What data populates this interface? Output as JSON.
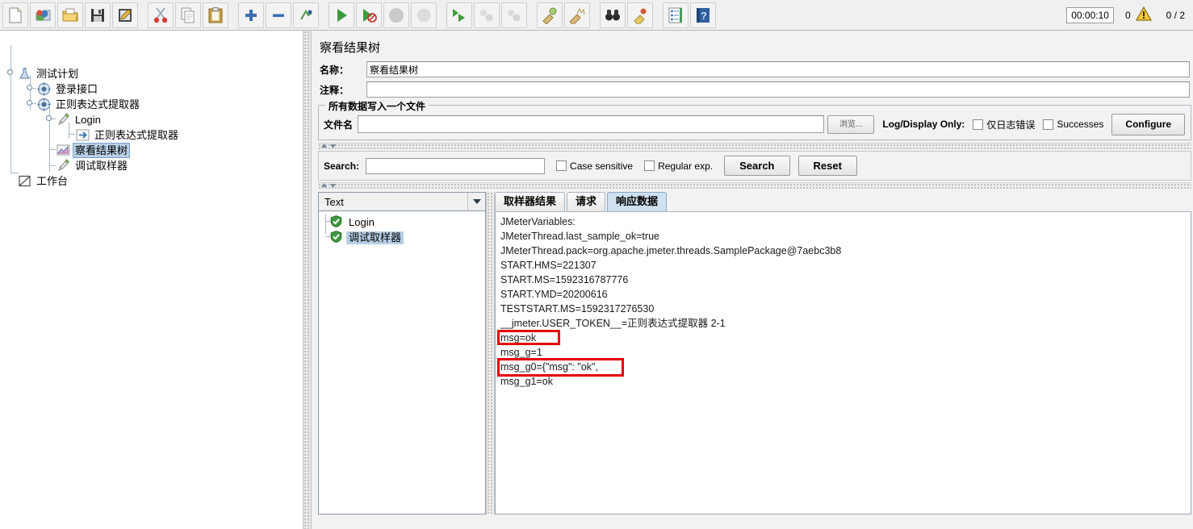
{
  "toolbar": {
    "buttons": [
      {
        "name": "new-test-plan",
        "icon": "new-file-icon",
        "tooltip": "New"
      },
      {
        "name": "templates",
        "icon": "templates-icon",
        "tooltip": "Templates"
      },
      {
        "name": "open",
        "icon": "open-folder-icon",
        "tooltip": "Open"
      },
      {
        "name": "save",
        "icon": "save-disk-icon",
        "tooltip": "Save"
      },
      {
        "name": "save-as",
        "icon": "save-as-icon",
        "tooltip": "Save Test Plan as"
      },
      {
        "name": "cut",
        "icon": "scissors-icon",
        "tooltip": "Cut"
      },
      {
        "name": "copy",
        "icon": "copy-icon",
        "tooltip": "Copy"
      },
      {
        "name": "paste",
        "icon": "clipboard-paste-icon",
        "tooltip": "Paste"
      },
      {
        "name": "expand-all",
        "icon": "plus-icon",
        "tooltip": "Expand All"
      },
      {
        "name": "collapse-all",
        "icon": "minus-icon",
        "tooltip": "Collapse All"
      },
      {
        "name": "toggle",
        "icon": "toggle-icon",
        "tooltip": "Toggle"
      },
      {
        "name": "start",
        "icon": "play-green-icon",
        "tooltip": "Start"
      },
      {
        "name": "start-no-pauses",
        "icon": "play-no-pause-icon",
        "tooltip": "Start no pauses"
      },
      {
        "name": "stop",
        "icon": "stop-disabled-icon",
        "tooltip": "Stop"
      },
      {
        "name": "shutdown",
        "icon": "shutdown-disabled-icon",
        "tooltip": "Shutdown"
      },
      {
        "name": "remote-start-all",
        "icon": "remote-start-icon",
        "tooltip": "Remote Start All"
      },
      {
        "name": "remote-stop-all",
        "icon": "remote-stop-disabled-icon",
        "tooltip": "Remote Stop All"
      },
      {
        "name": "remote-shutdown-all",
        "icon": "remote-shutdown-disabled-icon",
        "tooltip": "Remote Shutdown All"
      },
      {
        "name": "clear",
        "icon": "clear-broom-icon",
        "tooltip": "Clear"
      },
      {
        "name": "clear-all",
        "icon": "clear-all-broom-icon",
        "tooltip": "Clear All"
      },
      {
        "name": "search",
        "icon": "binoculars-icon",
        "tooltip": "Search"
      },
      {
        "name": "search-reset",
        "icon": "search-reset-icon",
        "tooltip": "Reset Search"
      },
      {
        "name": "function-helper",
        "icon": "function-list-icon",
        "tooltip": "Function Helper Dialog"
      },
      {
        "name": "help",
        "icon": "help-book-icon",
        "tooltip": "Help"
      }
    ],
    "status": {
      "elapsed_time": "00:00:10",
      "error_count": "0",
      "warn_icon": "warning-triangle-icon",
      "threads": "0 / 2"
    }
  },
  "tree": {
    "nodes": [
      {
        "label": "测试计划",
        "icon": "test-plan-icon",
        "depth": 0,
        "selected": false
      },
      {
        "label": "登录接口",
        "icon": "thread-group-icon",
        "depth": 1,
        "selected": false
      },
      {
        "label": "正则表达式提取器",
        "icon": "thread-group-icon",
        "depth": 1,
        "selected": false
      },
      {
        "label": "Login",
        "icon": "sampler-icon",
        "depth": 2,
        "selected": false
      },
      {
        "label": "正则表达式提取器",
        "icon": "post-processor-icon",
        "depth": 3,
        "selected": false
      },
      {
        "label": "察看结果树",
        "icon": "view-results-tree-icon",
        "depth": 2,
        "selected": true
      },
      {
        "label": "调试取样器",
        "icon": "sampler-icon",
        "depth": 2,
        "selected": false
      },
      {
        "label": "工作台",
        "icon": "workbench-icon",
        "depth": 0,
        "selected": false
      }
    ]
  },
  "panel": {
    "title": "察看结果树",
    "name_label": "名称：",
    "name_value": "察看结果树",
    "comment_label": "注释：",
    "comment_value": "",
    "file_group_title": "所有数据写入一个文件",
    "filename_label": "文件名",
    "filename_value": "",
    "filename_placeholder": "",
    "browse_button": "浏览...",
    "log_display_only_label": "Log/Display Only:",
    "errors_only_checkbox": "仅日志错误",
    "successes_checkbox": "Successes",
    "configure_button": "Configure"
  },
  "search_bar": {
    "label": "Search:",
    "value": "",
    "case_sensitive": "Case sensitive",
    "regular_exp": "Regular exp.",
    "search_button": "Search",
    "reset_button": "Reset"
  },
  "results": {
    "renderer_selected": "Text",
    "renderer_options": [
      "Text"
    ],
    "items": [
      {
        "label": "Login",
        "status": "success",
        "selected": false
      },
      {
        "label": "调试取样器",
        "status": "success",
        "selected": true
      }
    ],
    "tabs": [
      {
        "label": "取样器结果",
        "active": false
      },
      {
        "label": "请求",
        "active": false
      },
      {
        "label": "响应数据",
        "active": true
      }
    ],
    "response_lines": [
      "JMeterVariables:",
      "JMeterThread.last_sample_ok=true",
      "JMeterThread.pack=org.apache.jmeter.threads.SamplePackage@7aebc3b8",
      "START.HMS=221307",
      "START.MS=1592316787776",
      "START.YMD=20200616",
      "TESTSTART.MS=1592317276530",
      "__jmeter.USER_TOKEN__=正则表达式提取器 2-1",
      "msg=ok",
      "msg_g=1",
      "msg_g0={\"msg\": \"ok\",",
      "msg_g1=ok"
    ],
    "highlights": [
      {
        "line_index": 8,
        "name": "highlight-msg-ok"
      },
      {
        "line_index": 10,
        "name": "highlight-msg-g0"
      }
    ]
  },
  "colors": {
    "highlight_red": "#e50000",
    "selection_blue": "#b8cfe5",
    "tab_active": "#cfe0f0",
    "panel_bg": "#f2f2f2"
  }
}
